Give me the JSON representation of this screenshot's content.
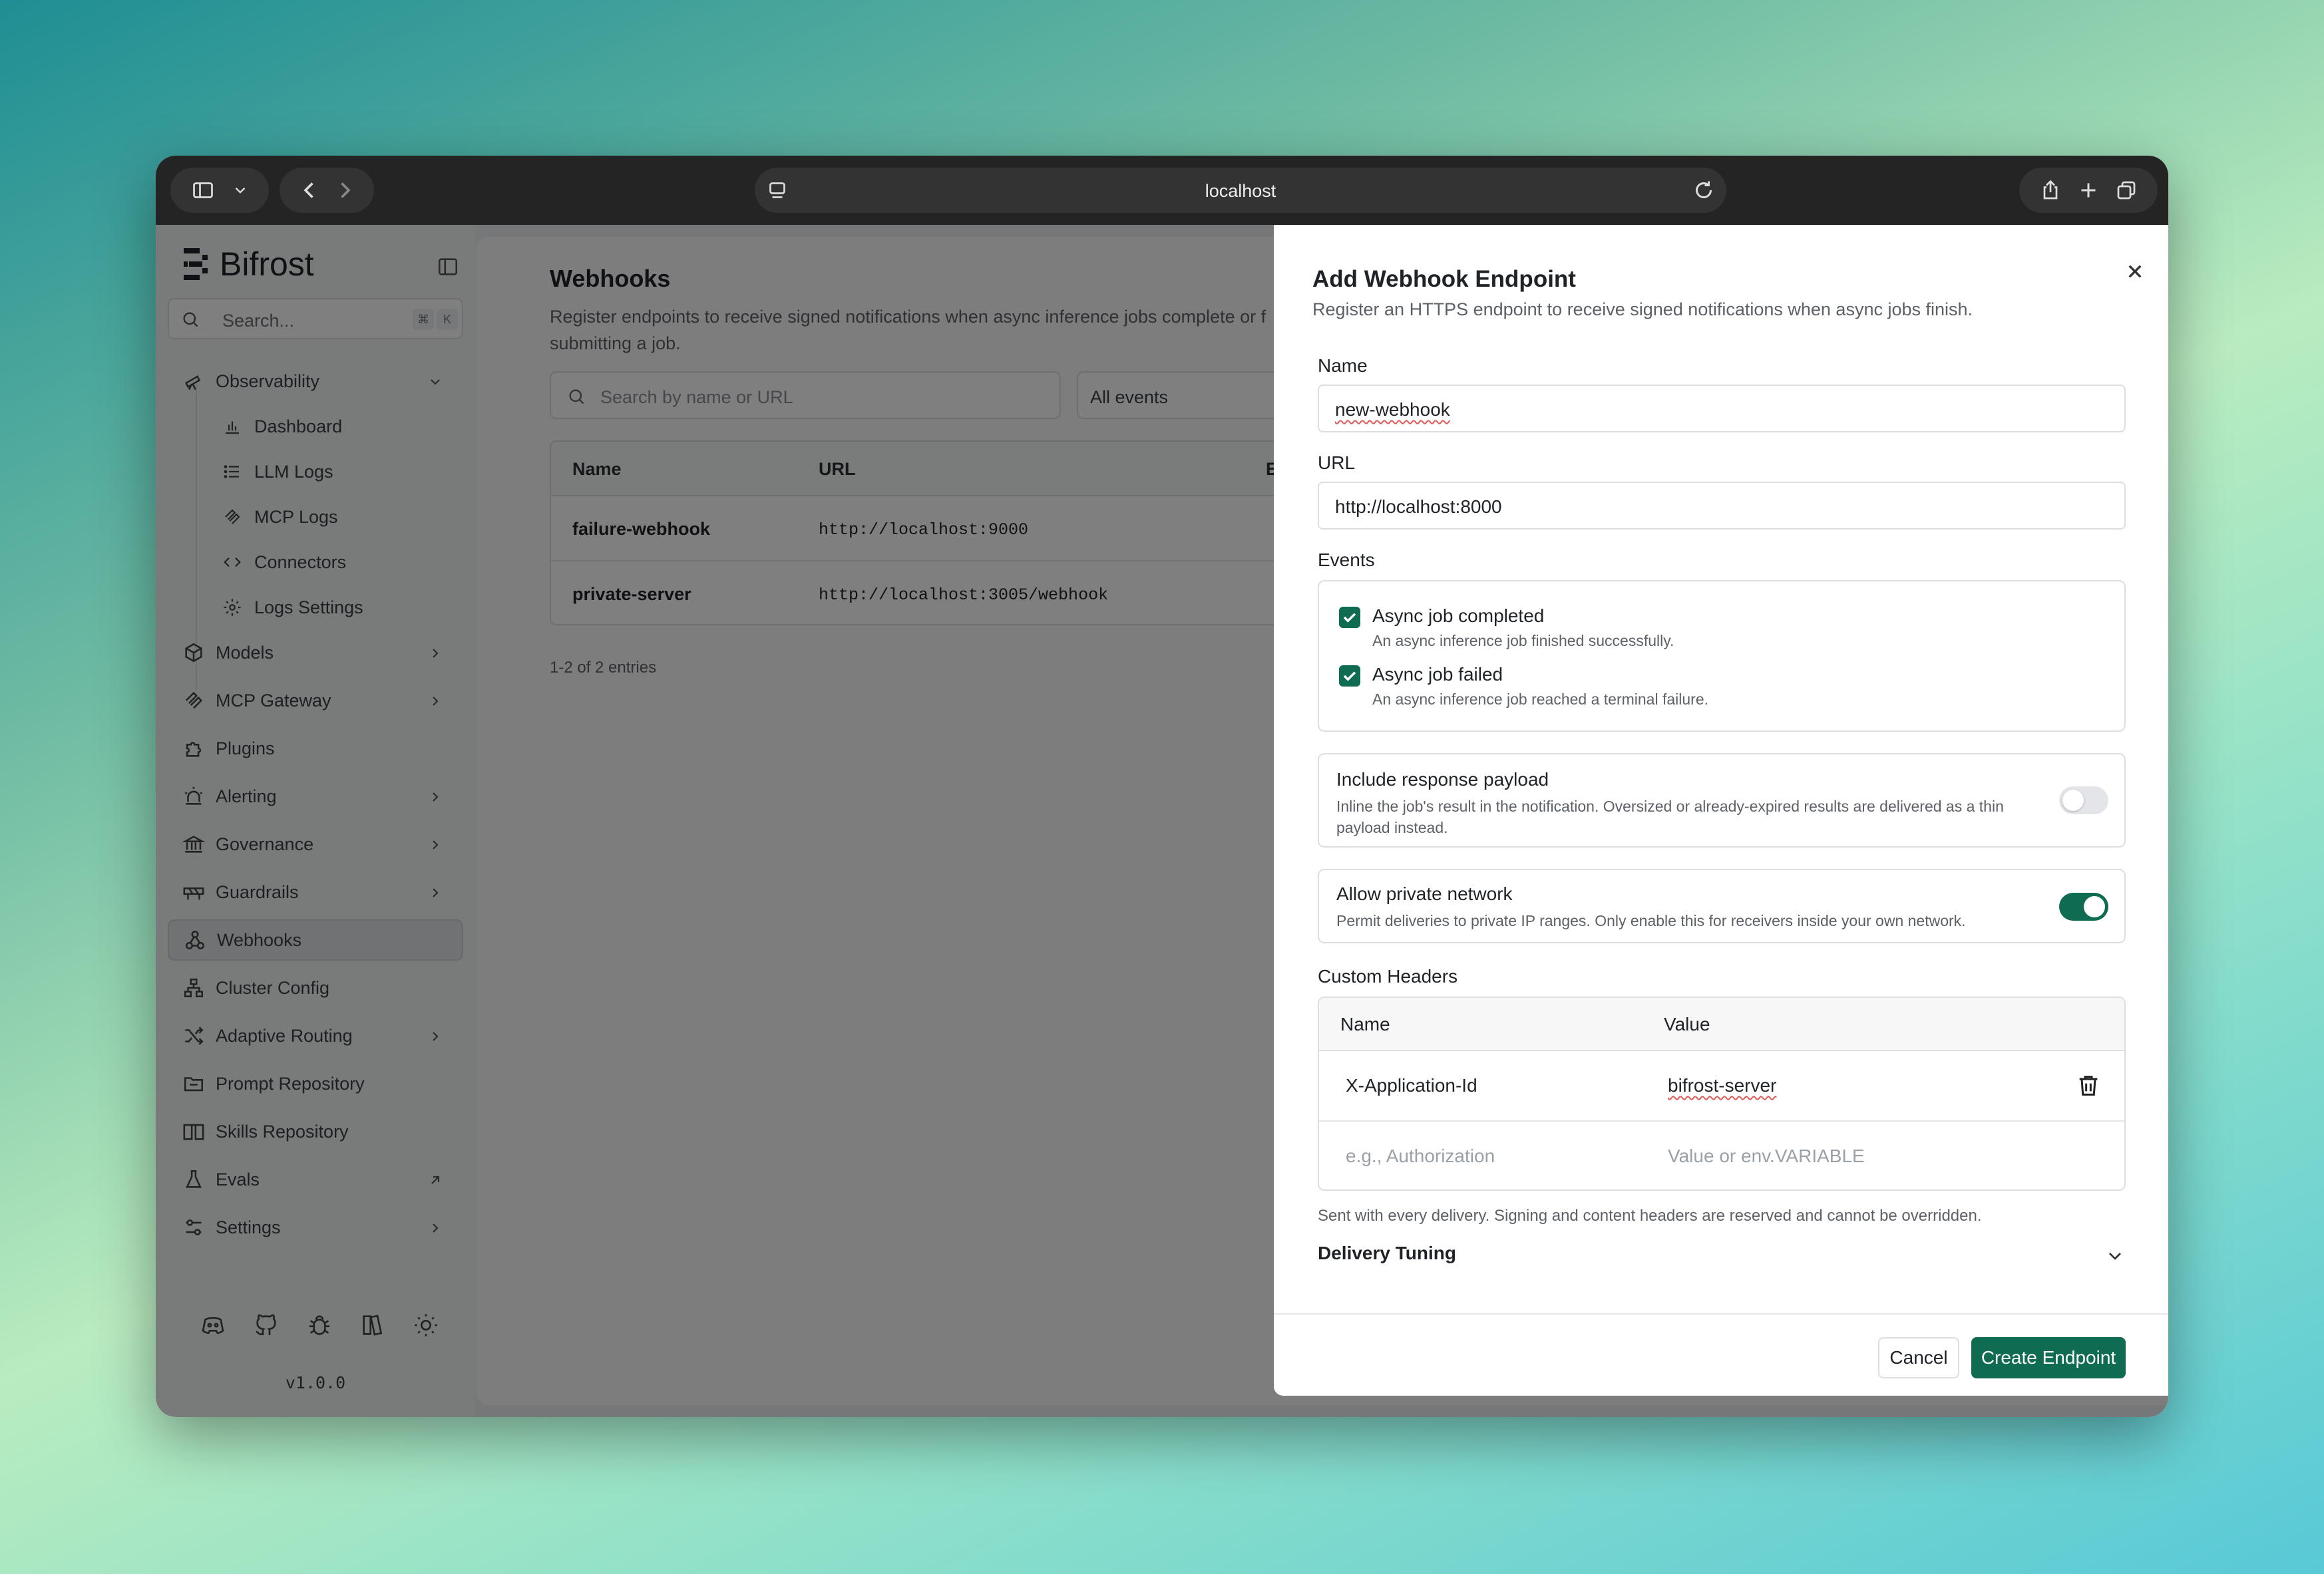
{
  "browser": {
    "url": "localhost"
  },
  "sidebar": {
    "brand": "Bifrost",
    "search_placeholder": "Search...",
    "shortcut": [
      "⌘",
      "K"
    ],
    "items": [
      {
        "label": "Observability",
        "icon": "telescope-icon",
        "expanded": true
      },
      {
        "label": "Models",
        "icon": "cube-icon"
      },
      {
        "label": "MCP Gateway",
        "icon": "mcp-icon"
      },
      {
        "label": "Plugins",
        "icon": "puzzle-icon"
      },
      {
        "label": "Alerting",
        "icon": "siren-icon"
      },
      {
        "label": "Governance",
        "icon": "landmark-icon"
      },
      {
        "label": "Guardrails",
        "icon": "barrier-icon"
      },
      {
        "label": "Webhooks",
        "icon": "webhook-icon",
        "active": true
      },
      {
        "label": "Cluster Config",
        "icon": "network-icon"
      },
      {
        "label": "Adaptive Routing",
        "icon": "shuffle-icon"
      },
      {
        "label": "Prompt Repository",
        "icon": "folder-icon"
      },
      {
        "label": "Skills Repository",
        "icon": "book-icon"
      },
      {
        "label": "Evals",
        "icon": "flask-icon"
      },
      {
        "label": "Settings",
        "icon": "sliders-icon"
      }
    ],
    "sub_items": [
      {
        "label": "Dashboard",
        "icon": "chart-icon"
      },
      {
        "label": "LLM Logs",
        "icon": "list-icon"
      },
      {
        "label": "MCP Logs",
        "icon": "mcp-icon"
      },
      {
        "label": "Connectors",
        "icon": "code-icon"
      },
      {
        "label": "Logs Settings",
        "icon": "gear-icon"
      }
    ],
    "version": "v1.0.0"
  },
  "page": {
    "title": "Webhooks",
    "description": "Register endpoints to receive signed notifications when async inference jobs complete or f",
    "description_line2": "submitting a job.",
    "search_placeholder": "Search by name or URL",
    "filter_value": "All events",
    "columns": [
      "Name",
      "URL",
      "E"
    ],
    "rows": [
      {
        "name": "failure-webhook",
        "url": "http://localhost:9000"
      },
      {
        "name": "private-server",
        "url": "http://localhost:3005/webhook"
      }
    ],
    "count": "1-2 of 2 entries"
  },
  "modal": {
    "title": "Add Webhook Endpoint",
    "subtitle": "Register an HTTPS endpoint to receive signed notifications when async jobs finish.",
    "name_label": "Name",
    "name_value": "new-webhook",
    "url_label": "URL",
    "url_value": "http://localhost:8000",
    "events_label": "Events",
    "events": [
      {
        "label": "Async job completed",
        "description": "An async inference job finished successfully.",
        "checked": true
      },
      {
        "label": "Async job failed",
        "description": "An async inference job reached a terminal failure.",
        "checked": true
      }
    ],
    "include_payload": {
      "title": "Include response payload",
      "description": "Inline the job's result in the notification. Oversized or already-expired results are delivered as a thin payload instead.",
      "on": false
    },
    "private_network": {
      "title": "Allow private network",
      "description": "Permit deliveries to private IP ranges. Only enable this for receivers inside your own network.",
      "on": true
    },
    "headers_label": "Custom Headers",
    "headers_columns": [
      "Name",
      "Value"
    ],
    "headers": [
      {
        "name": "X-Application-Id",
        "value": "bifrost-server"
      }
    ],
    "new_header_name_placeholder": "e.g., Authorization",
    "new_header_value_placeholder": "Value or env.VARIABLE",
    "headers_note": "Sent with every delivery. Signing and content headers are reserved and cannot be overridden.",
    "delivery_tuning": "Delivery Tuning",
    "cancel_label": "Cancel",
    "create_label": "Create Endpoint"
  },
  "colors": {
    "accent": "#0f6b52",
    "toggle_off": "#e3e5e8"
  }
}
